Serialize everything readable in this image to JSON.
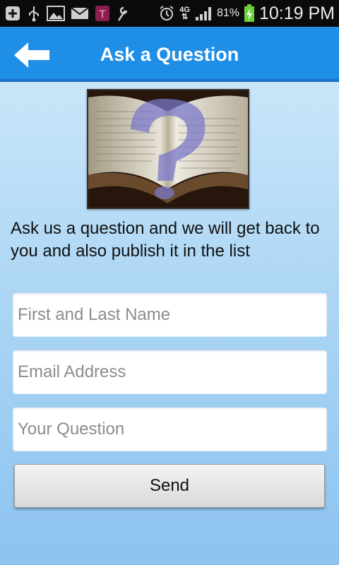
{
  "status_bar": {
    "network": "4G",
    "battery_percent": "81%",
    "time": "10:19 PM",
    "icons": [
      "add-icon",
      "usb-icon",
      "image-icon",
      "mail-icon",
      "t-mobile-icon",
      "alarm-icon",
      "signal-icon",
      "battery-charging-icon"
    ]
  },
  "action_bar": {
    "title": "Ask a Question",
    "back_icon": "back-arrow-icon"
  },
  "intro_text": "Ask us a question and we will get back to you and also publish it in the list",
  "form": {
    "name_placeholder": "First and Last Name",
    "email_placeholder": "Email Address",
    "question_placeholder": "Your Question",
    "send_label": "Send"
  },
  "colors": {
    "action_bar": "#1f8ee6",
    "background_top": "#d6ecfb",
    "background_bottom": "#8cc3f0"
  }
}
